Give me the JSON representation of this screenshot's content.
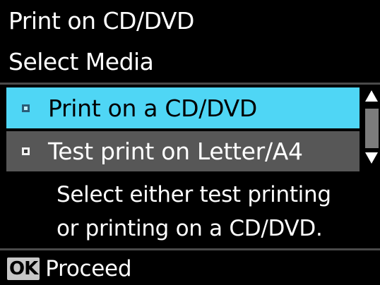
{
  "header": {
    "title": "Print on CD/DVD",
    "subtitle": "Select Media"
  },
  "menu": {
    "items": [
      {
        "label": "Print on a CD/DVD",
        "selected": true
      },
      {
        "label": "Test print on Letter/A4",
        "selected": false
      }
    ]
  },
  "description": {
    "line1": "Select either test printing",
    "line2": "or printing on a CD/DVD."
  },
  "footer": {
    "ok_key": "OK",
    "ok_action": "Proceed"
  },
  "colors": {
    "background": "#000000",
    "selection": "#4fd6f5",
    "unselected_row": "#575757",
    "text": "#ffffff"
  },
  "icons": {
    "scroll_up": "triangle-up-icon",
    "scroll_down": "triangle-down-icon",
    "bullet": "square-bullet-icon"
  }
}
